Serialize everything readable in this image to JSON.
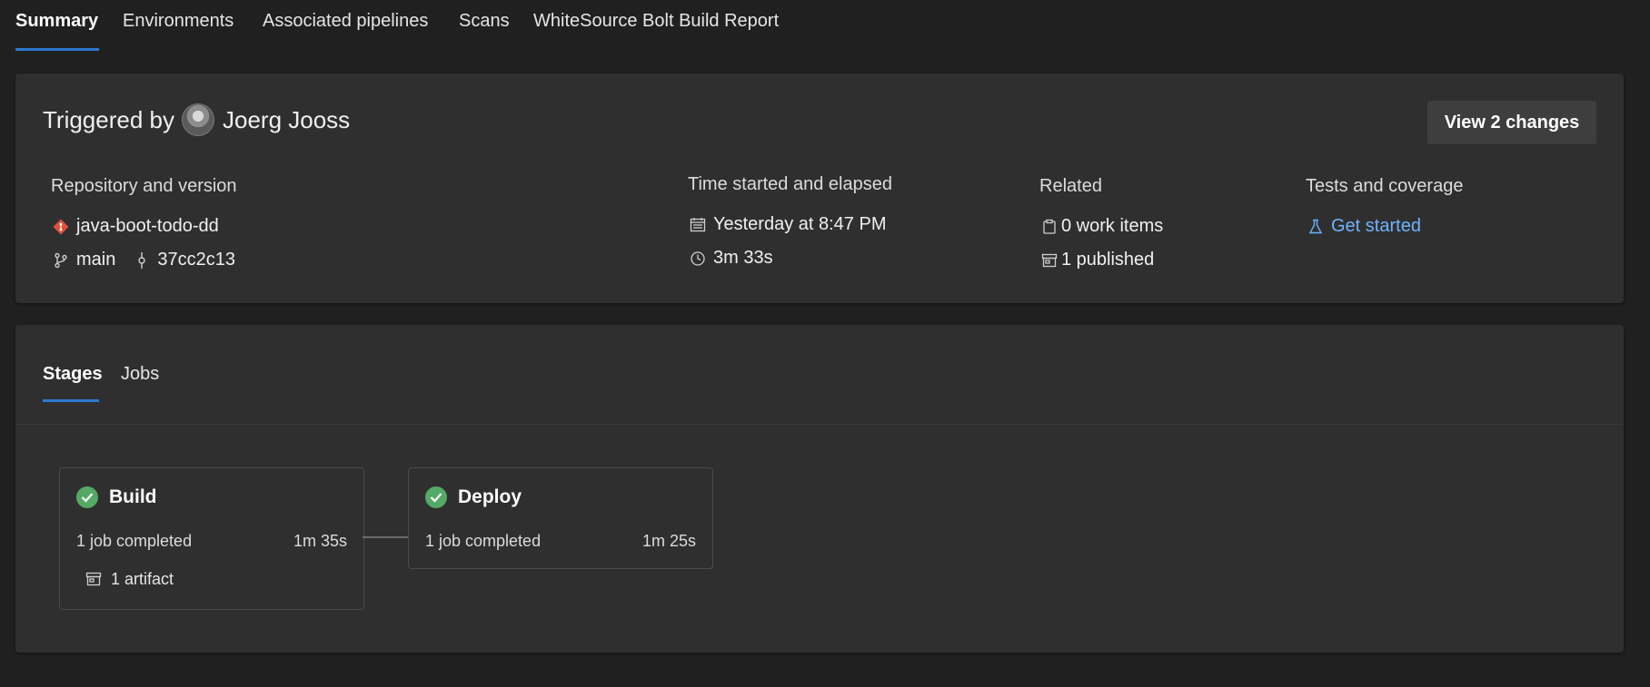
{
  "tabs": [
    "Summary",
    "Environments",
    "Associated pipelines",
    "Scans",
    "WhiteSource Bolt Build Report"
  ],
  "summary": {
    "triggered_prefix": "Triggered by",
    "user": "Joerg Jooss",
    "view_changes": "View 2 changes",
    "repo": {
      "heading": "Repository and version",
      "name": "java-boot-todo-dd",
      "branch": "main",
      "commit": "37cc2c13"
    },
    "time": {
      "heading": "Time started and elapsed",
      "started": "Yesterday at 8:47 PM",
      "elapsed": "3m 33s"
    },
    "related": {
      "heading": "Related",
      "work_items": "0 work items",
      "published": "1 published"
    },
    "tests": {
      "heading": "Tests and coverage",
      "link": "Get started"
    }
  },
  "stages_panel": {
    "tabs": [
      "Stages",
      "Jobs"
    ],
    "stages": [
      {
        "name": "Build",
        "status": "1 job completed",
        "duration": "1m 35s",
        "artifact": "1 artifact"
      },
      {
        "name": "Deploy",
        "status": "1 job completed",
        "duration": "1m 25s"
      }
    ]
  },
  "colors": {
    "accent": "#2b79d0",
    "success": "#54a966",
    "link": "#6fb3ff",
    "repo_icon": "#e0523a"
  },
  "icons": [
    "git-repo-icon",
    "branch-icon",
    "commit-icon",
    "calendar-icon",
    "clock-icon",
    "work-item-icon",
    "artifact-icon",
    "flask-icon",
    "check-circle-icon"
  ]
}
